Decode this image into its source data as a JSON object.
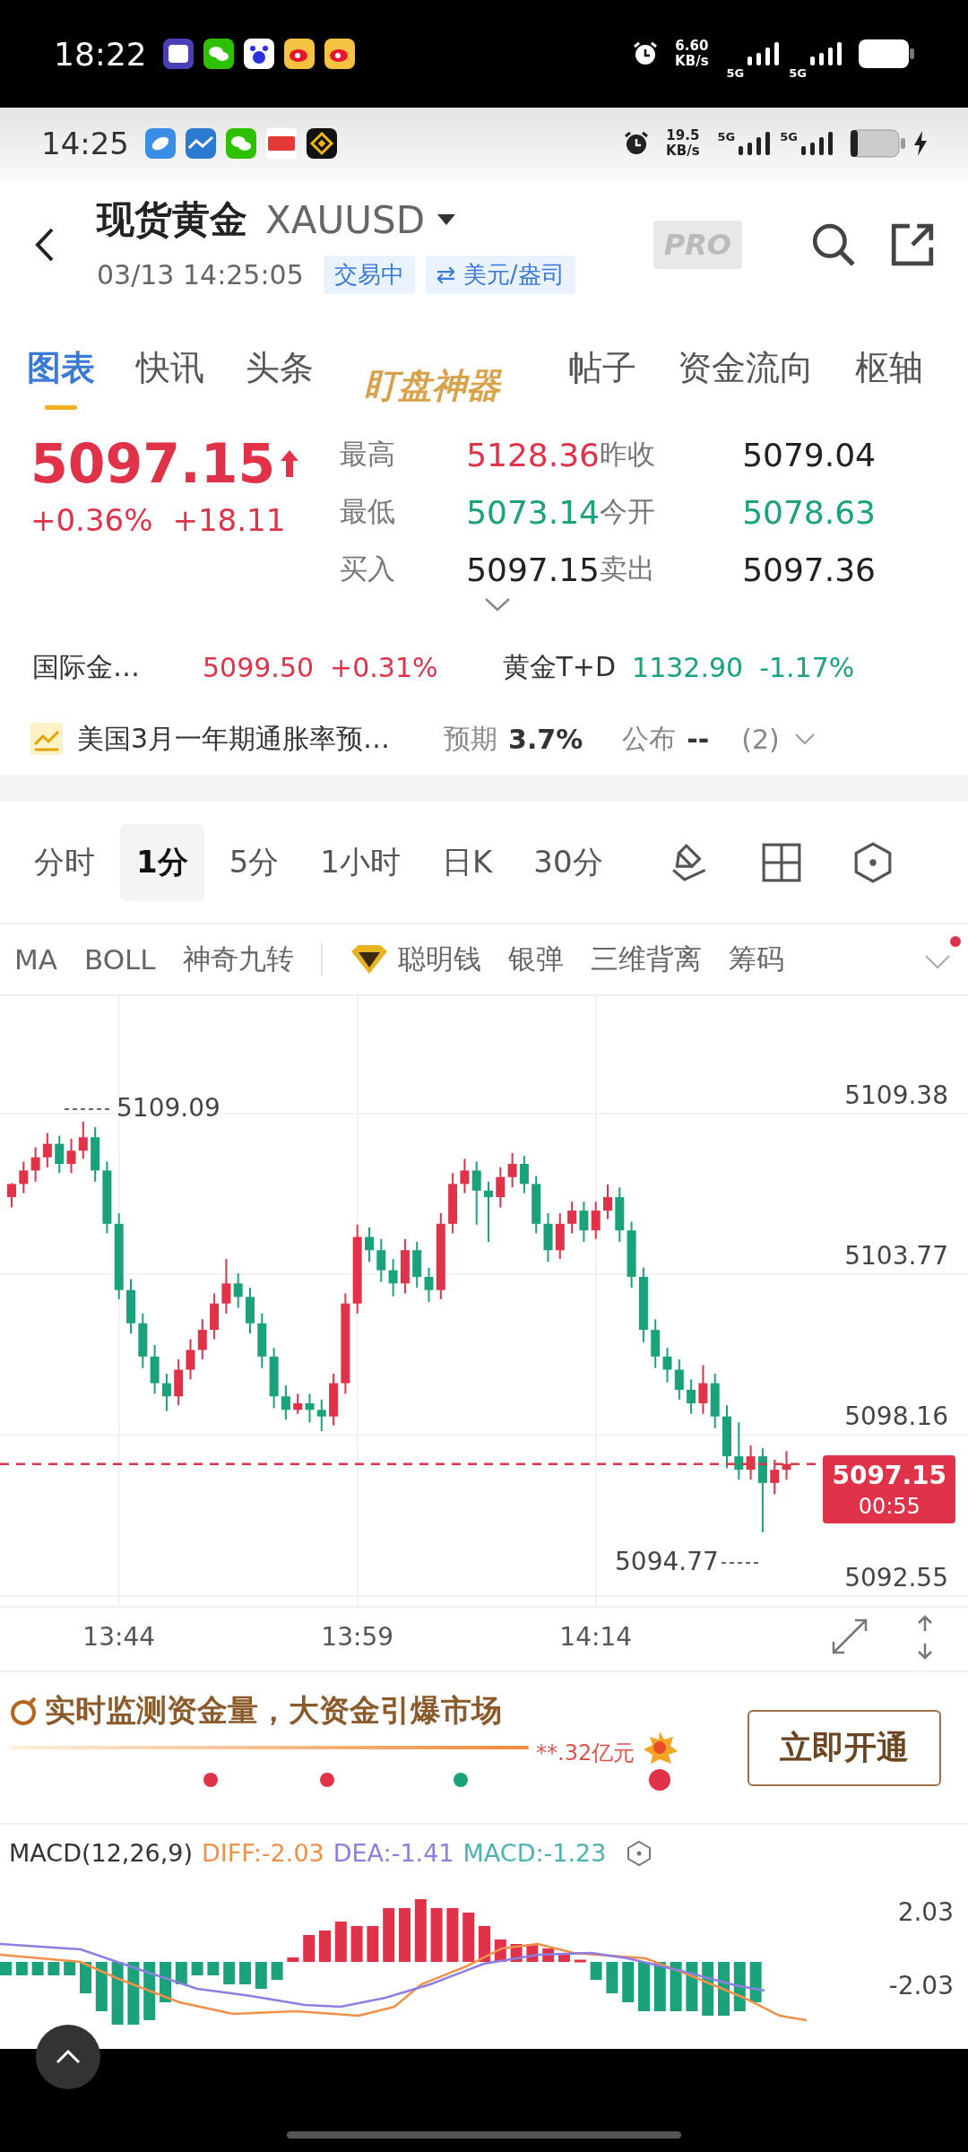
{
  "outer_status_bar": {
    "time": "18:22",
    "speed": "6.60",
    "speed_unit": "KB/s",
    "network_1": "5G",
    "network_2": "5G"
  },
  "inner_status_bar": {
    "time": "14:25",
    "speed": "19.5",
    "speed_unit": "KB/s",
    "network_1": "5G",
    "network_2": "5G"
  },
  "header": {
    "title": "现货黄金",
    "symbol": "XAUUSD",
    "datetime": "03/13 14:25:05",
    "status_badge": "交易中",
    "unit_badge": "⇄ 美元/盎司",
    "pro_badge": "PRO"
  },
  "tabs": [
    {
      "label": "图表",
      "selected": true,
      "kind": "normal"
    },
    {
      "label": "快讯",
      "selected": false,
      "kind": "normal"
    },
    {
      "label": "头条",
      "selected": false,
      "kind": "normal"
    },
    {
      "label": "盯盘神器",
      "selected": false,
      "kind": "promo"
    },
    {
      "label": "帖子",
      "selected": false,
      "kind": "normal"
    },
    {
      "label": "资金流向",
      "selected": false,
      "kind": "normal"
    },
    {
      "label": "枢轴",
      "selected": false,
      "kind": "normal"
    }
  ],
  "quote": {
    "price": "5097.15",
    "color": "#e0334a",
    "change_percent": "+0.36%",
    "change": "+18.11",
    "stats": [
      {
        "label": "最高",
        "value": "5128.36",
        "color": "#e0334a"
      },
      {
        "label": "昨收",
        "value": "5079.04",
        "color": "#222222"
      },
      {
        "label": "最低",
        "value": "5073.14",
        "color": "#1aa37a"
      },
      {
        "label": "今开",
        "value": "5078.63",
        "color": "#1aa37a"
      },
      {
        "label": "买入",
        "value": "5097.15",
        "color": "#222222"
      },
      {
        "label": "卖出",
        "value": "5097.36",
        "color": "#222222"
      }
    ]
  },
  "related": [
    {
      "name": "国际金…",
      "price": "5099.50",
      "change": "+0.31%",
      "color": "#e0334a"
    },
    {
      "name": "黄金T+D",
      "price": "1132.90",
      "change": "-1.17%",
      "color": "#1aa37a"
    }
  ],
  "event": {
    "title": "美国3月一年期通胀率预…",
    "expected_label": "预期",
    "expected": "3.7%",
    "published_label": "公布",
    "published": "--",
    "count": "(2)"
  },
  "intervals": [
    {
      "label": "分时",
      "selected": false
    },
    {
      "label": "1分",
      "selected": true
    },
    {
      "label": "5分",
      "selected": false
    },
    {
      "label": "1小时",
      "selected": false
    },
    {
      "label": "日K",
      "selected": false
    },
    {
      "label": "30分",
      "selected": false
    }
  ],
  "indicators": [
    {
      "label": "MA",
      "kind": "plain"
    },
    {
      "label": "BOLL",
      "kind": "plain"
    },
    {
      "label": "神奇九转",
      "kind": "plain"
    },
    {
      "label": "聪明钱",
      "kind": "premium"
    },
    {
      "label": "银弹",
      "kind": "plain"
    },
    {
      "label": "三维背离",
      "kind": "plain"
    },
    {
      "label": "筹码",
      "kind": "plain"
    }
  ],
  "price_chart": {
    "high_label": "5109.09",
    "low_label": "5094.77",
    "countdown": "00:55",
    "time_labels": [
      "13:44",
      "13:59",
      "14:14"
    ],
    "chart_data": {
      "type": "candlestick",
      "ylim": [
        5092.2,
        5113.47
      ],
      "grid": true,
      "ref_lines": [
        {
          "value": 5097.15,
          "axis": "y",
          "label": "5097.15",
          "color": "#e0334a"
        }
      ],
      "yticks": [
        5109.38,
        5103.77,
        5098.16,
        5092.55
      ],
      "ohlc": [
        [
          5106.46,
          5106.95,
          5106.1,
          5106.92
        ],
        [
          5106.92,
          5107.7,
          5106.6,
          5107.39
        ],
        [
          5107.39,
          5108.2,
          5107.0,
          5107.85
        ],
        [
          5107.85,
          5108.7,
          5107.5,
          5108.32
        ],
        [
          5108.32,
          5108.6,
          5107.3,
          5107.62
        ],
        [
          5107.62,
          5108.5,
          5107.3,
          5108.08
        ],
        [
          5108.08,
          5109.09,
          5107.8,
          5108.55
        ],
        [
          5108.55,
          5108.9,
          5107.0,
          5107.39
        ],
        [
          5107.39,
          5107.7,
          5105.2,
          5105.53
        ],
        [
          5105.53,
          5105.9,
          5102.9,
          5103.22
        ],
        [
          5103.22,
          5103.6,
          5101.7,
          5102.06
        ],
        [
          5102.06,
          5102.4,
          5100.5,
          5100.9
        ],
        [
          5100.9,
          5101.3,
          5099.6,
          5099.97
        ],
        [
          5099.97,
          5100.3,
          5099.0,
          5099.51
        ],
        [
          5099.51,
          5100.8,
          5099.2,
          5100.44
        ],
        [
          5100.44,
          5101.5,
          5100.1,
          5101.13
        ],
        [
          5101.13,
          5102.2,
          5100.8,
          5101.83
        ],
        [
          5101.83,
          5103.1,
          5101.5,
          5102.75
        ],
        [
          5102.75,
          5104.3,
          5102.4,
          5103.45
        ],
        [
          5103.45,
          5103.8,
          5102.6,
          5102.98
        ],
        [
          5102.98,
          5103.3,
          5101.7,
          5102.06
        ],
        [
          5102.06,
          5102.4,
          5100.5,
          5100.9
        ],
        [
          5100.9,
          5101.2,
          5099.1,
          5099.51
        ],
        [
          5099.51,
          5099.9,
          5098.7,
          5099.04
        ],
        [
          5099.04,
          5099.6,
          5098.9,
          5099.27
        ],
        [
          5099.27,
          5099.6,
          5098.6,
          5099.04
        ],
        [
          5099.04,
          5099.4,
          5098.3,
          5098.81
        ],
        [
          5098.81,
          5100.3,
          5098.5,
          5099.97
        ],
        [
          5099.97,
          5103.1,
          5099.6,
          5102.75
        ],
        [
          5102.75,
          5105.5,
          5102.4,
          5105.07
        ],
        [
          5105.07,
          5105.4,
          5104.2,
          5104.61
        ],
        [
          5104.61,
          5105.0,
          5103.5,
          5103.91
        ],
        [
          5103.91,
          5104.3,
          5103.0,
          5103.45
        ],
        [
          5103.45,
          5105.0,
          5103.1,
          5104.61
        ],
        [
          5104.61,
          5104.9,
          5103.3,
          5103.68
        ],
        [
          5103.68,
          5104.0,
          5102.8,
          5103.22
        ],
        [
          5103.22,
          5105.9,
          5102.9,
          5105.53
        ],
        [
          5105.53,
          5107.3,
          5105.2,
          5106.92
        ],
        [
          5106.92,
          5107.8,
          5106.6,
          5107.39
        ],
        [
          5107.39,
          5107.7,
          5105.5,
          5106.69
        ],
        [
          5106.69,
          5107.0,
          5104.9,
          5106.46
        ],
        [
          5106.46,
          5107.5,
          5106.1,
          5107.16
        ],
        [
          5107.16,
          5108.0,
          5106.8,
          5107.62
        ],
        [
          5107.62,
          5107.9,
          5106.6,
          5106.92
        ],
        [
          5106.92,
          5107.2,
          5105.2,
          5105.53
        ],
        [
          5105.53,
          5105.9,
          5104.2,
          5104.61
        ],
        [
          5104.61,
          5105.9,
          5104.3,
          5105.53
        ],
        [
          5105.53,
          5106.3,
          5105.2,
          5105.99
        ],
        [
          5105.99,
          5106.3,
          5104.9,
          5105.3
        ],
        [
          5105.3,
          5106.3,
          5105.0,
          5105.99
        ],
        [
          5105.99,
          5106.9,
          5105.7,
          5106.46
        ],
        [
          5106.46,
          5106.8,
          5104.9,
          5105.3
        ],
        [
          5105.3,
          5105.6,
          5103.3,
          5103.68
        ],
        [
          5103.68,
          5104.0,
          5101.4,
          5101.83
        ],
        [
          5101.83,
          5102.2,
          5100.5,
          5100.9
        ],
        [
          5100.9,
          5101.2,
          5100.0,
          5100.44
        ],
        [
          5100.44,
          5100.8,
          5099.4,
          5099.74
        ],
        [
          5099.74,
          5100.1,
          5098.9,
          5099.27
        ],
        [
          5099.27,
          5100.6,
          5098.9,
          5099.97
        ],
        [
          5099.97,
          5100.3,
          5098.4,
          5098.81
        ],
        [
          5098.81,
          5099.2,
          5097.0,
          5097.42
        ],
        [
          5097.42,
          5098.6,
          5096.6,
          5096.95
        ],
        [
          5096.95,
          5097.8,
          5096.6,
          5097.42
        ],
        [
          5097.42,
          5097.7,
          5094.77,
          5096.49
        ],
        [
          5096.49,
          5097.3,
          5096.1,
          5096.95
        ],
        [
          5096.95,
          5097.6,
          5096.6,
          5097.15
        ]
      ]
    }
  },
  "promo": {
    "text": "实时监测资金量，大资金引爆市场",
    "amount": "**.32亿元",
    "button": "立即开通"
  },
  "macd": {
    "name": "MACD(12,26,9)",
    "diff": "DIFF:-2.03",
    "dea": "DEA:-1.41",
    "macd": "MACD:-1.23",
    "axis_labels": [
      "2.03",
      "-2.03"
    ]
  }
}
